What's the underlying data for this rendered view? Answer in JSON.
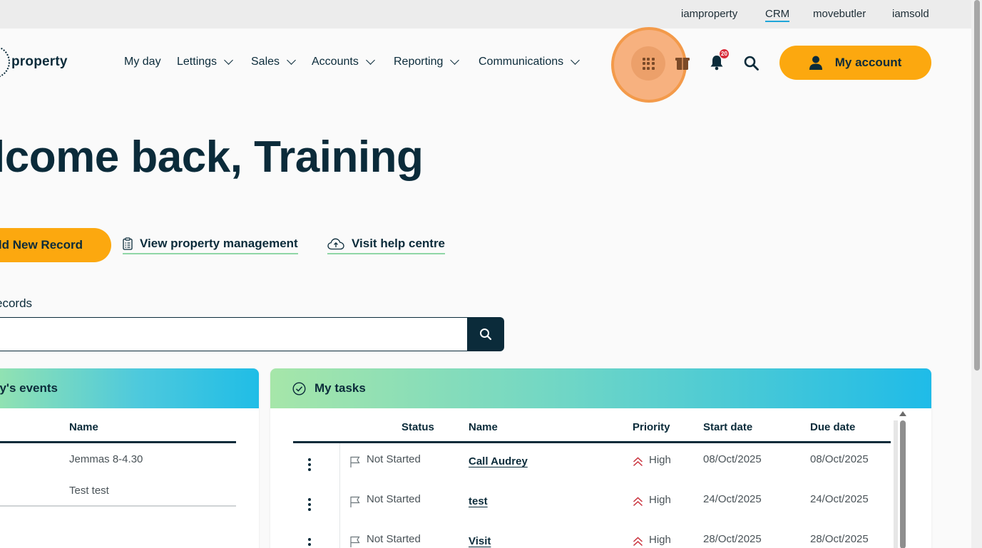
{
  "topbar": {
    "links": [
      "iamproperty",
      "CRM",
      "movebutler",
      "iamsold"
    ],
    "active": "CRM"
  },
  "logo": {
    "text": "property"
  },
  "nav": {
    "items": [
      {
        "label": "My day",
        "dropdown": false
      },
      {
        "label": "Lettings",
        "dropdown": true
      },
      {
        "label": "Sales",
        "dropdown": true
      },
      {
        "label": "Accounts",
        "dropdown": true
      },
      {
        "label": "Reporting",
        "dropdown": true
      },
      {
        "label": "Communications",
        "dropdown": true
      }
    ],
    "icons": [
      "apps-grid-icon",
      "gift-icon",
      "bell-icon",
      "search-icon"
    ],
    "notification_count": "20",
    "account_label": "My account"
  },
  "welcome": "lcome back, Training",
  "actions": {
    "add_record": "ld New Record",
    "view_property": "View property management",
    "help_centre": "Visit help centre"
  },
  "search": {
    "label": "ecords",
    "placeholder": ""
  },
  "events_panel": {
    "title": "ay's events",
    "column": "Name",
    "rows": [
      "Jemmas 8-4.30",
      "Test test"
    ]
  },
  "tasks_panel": {
    "title": "My tasks",
    "columns": {
      "status": "Status",
      "name": "Name",
      "priority": "Priority",
      "start": "Start date",
      "due": "Due date"
    },
    "rows": [
      {
        "status": "Not Started",
        "name": "Call Audrey",
        "priority": "High",
        "start": "08/Oct/2025",
        "due": "08/Oct/2025"
      },
      {
        "status": "Not Started",
        "name": "test",
        "priority": "High",
        "start": "24/Oct/2025",
        "due": "24/Oct/2025"
      },
      {
        "status": "Not Started",
        "name": "Visit",
        "priority": "High",
        "start": "28/Oct/2025",
        "due": "28/Oct/2025"
      }
    ]
  },
  "colors": {
    "accent": "#fca80f",
    "navy": "#0b2b3a",
    "highlight": "#f39a4a"
  }
}
